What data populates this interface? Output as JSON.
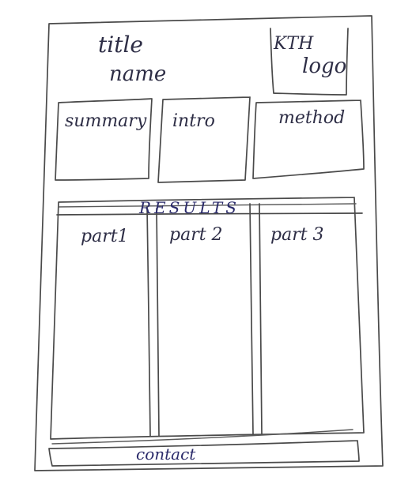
{
  "header": {
    "title_line1": "title",
    "title_line2": "name",
    "logo_line1": "KTH",
    "logo_line2": "logo"
  },
  "intro_row": {
    "summary": "summary",
    "intro": "intro",
    "method": "method"
  },
  "results": {
    "heading": "RESULTS",
    "parts": [
      "part1",
      "part 2",
      "part 3"
    ]
  },
  "footer": {
    "contact": "contact"
  }
}
